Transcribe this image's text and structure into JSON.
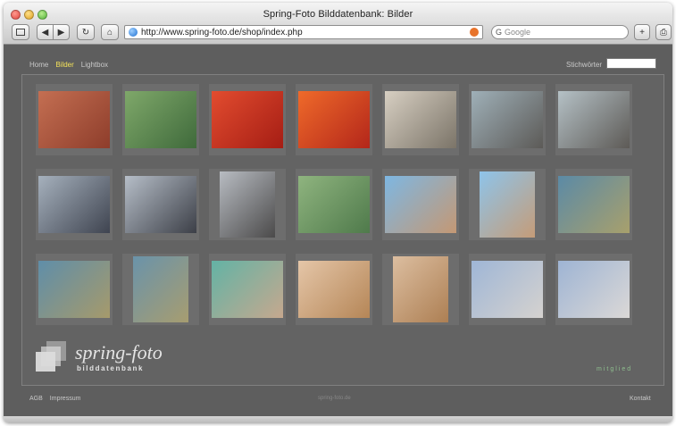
{
  "window": {
    "title": "Spring-Foto Bilddatenbank: Bilder"
  },
  "toolbar": {
    "url": "http://www.spring-foto.de/shop/index.php",
    "search_placeholder": "Google",
    "sidebar_icon": "sidebar-icon",
    "back_glyph": "◀",
    "forward_glyph": "▶",
    "reload_glyph": "↻",
    "home_glyph": "⌂",
    "add_glyph": "+",
    "print_glyph": "⎙"
  },
  "nav": {
    "items": [
      "Home",
      "Bilder",
      "Lightbox"
    ],
    "active": "Bilder"
  },
  "search": {
    "label": "Stichwörter"
  },
  "gallery": {
    "thumbnails": [
      {
        "name": "cooking-fish-grill",
        "colors": [
          "#c46f52",
          "#8e3d2b"
        ]
      },
      {
        "name": "green-leaves",
        "colors": [
          "#7fa86a",
          "#3f6a3b"
        ]
      },
      {
        "name": "red-flower",
        "colors": [
          "#e24c2f",
          "#a51d14"
        ]
      },
      {
        "name": "red-flower-closeup",
        "colors": [
          "#ef6a2a",
          "#b3261a"
        ]
      },
      {
        "name": "fisherman-sitting",
        "colors": [
          "#d7cfc2",
          "#7b7468"
        ]
      },
      {
        "name": "fish-in-bowl",
        "colors": [
          "#9fb0b8",
          "#5c5a57"
        ]
      },
      {
        "name": "fish-in-bowl-2",
        "colors": [
          "#b5c1c6",
          "#5d5a56"
        ]
      },
      {
        "name": "fish-stack",
        "colors": [
          "#a6b1bd",
          "#3f4450"
        ]
      },
      {
        "name": "fish-stack-2",
        "colors": [
          "#b6bec8",
          "#3c3f47"
        ]
      },
      {
        "name": "fish-row",
        "colors": [
          "#b8bcc2",
          "#4b4a4a"
        ]
      },
      {
        "name": "green-net",
        "colors": [
          "#8fb47f",
          "#4f7a4b"
        ]
      },
      {
        "name": "rope-knot-sky",
        "colors": [
          "#7eb7e2",
          "#c49874"
        ]
      },
      {
        "name": "rope-knot-sky-2",
        "colors": [
          "#8ec4ea",
          "#c59c78"
        ]
      },
      {
        "name": "boat-pole-water",
        "colors": [
          "#5b8aa6",
          "#a8a06c"
        ]
      },
      {
        "name": "boat-pole-water-2",
        "colors": [
          "#5f8ea9",
          "#a69a6b"
        ]
      },
      {
        "name": "boat-pole-water-3",
        "colors": [
          "#6a93aa",
          "#a79d70"
        ]
      },
      {
        "name": "hands-net-water",
        "colors": [
          "#63b3a5",
          "#c6a88e"
        ]
      },
      {
        "name": "dried-fish",
        "colors": [
          "#e5c6a8",
          "#b58657"
        ]
      },
      {
        "name": "dried-fish-2",
        "colors": [
          "#dcbea0",
          "#ad7f53"
        ]
      },
      {
        "name": "bottle-sky",
        "colors": [
          "#9fb6d6",
          "#d5d2cf"
        ]
      },
      {
        "name": "bottle-sky-2",
        "colors": [
          "#9eb4d4",
          "#dbd8d6"
        ]
      }
    ]
  },
  "branding": {
    "logo_text": "spring-foto",
    "logo_sub": "bilddatenbank",
    "small_text": "mitglied"
  },
  "footer": {
    "left": [
      "AGB",
      "Impressum"
    ],
    "center": "spring-foto.de",
    "right": "Kontakt"
  }
}
